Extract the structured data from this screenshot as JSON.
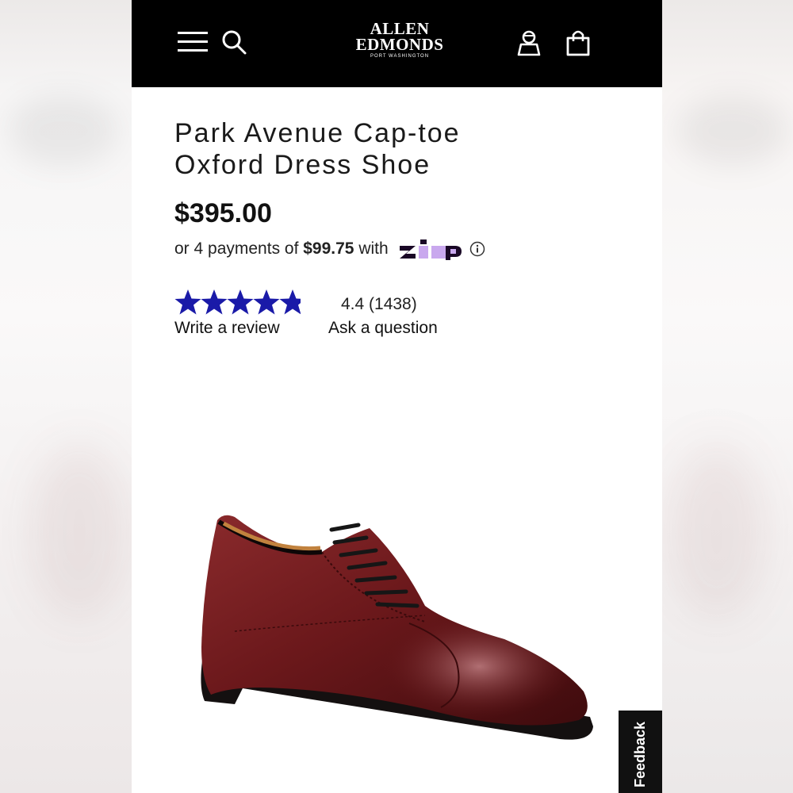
{
  "brand": {
    "line1": "ALLEN",
    "line2": "EDMONDS",
    "line3": "PORT WASHINGTON"
  },
  "header": {
    "icons": [
      "menu-icon",
      "search-icon",
      "account-icon",
      "shopping-bag-icon"
    ]
  },
  "product": {
    "title_line1": "Park Avenue Cap-toe",
    "title_line2": "Oxford Dress Shoe",
    "price": "$395.00",
    "installments": {
      "prefix": "or 4 payments of ",
      "amount": "$99.75",
      "suffix": " with",
      "provider": "zip"
    }
  },
  "reviews": {
    "stars": 4.4,
    "max_stars": 5,
    "rating_text": "4.4 (1438)",
    "write_review": "Write a review",
    "ask_question": "Ask a question"
  },
  "feedback": {
    "label": "Feedback"
  },
  "colors": {
    "header_bg": "#000000",
    "star": "#1a1aa8",
    "zip_purple": "#c9a8ee",
    "zip_navy": "#1a0826",
    "shoe": "#6e1a1d"
  }
}
